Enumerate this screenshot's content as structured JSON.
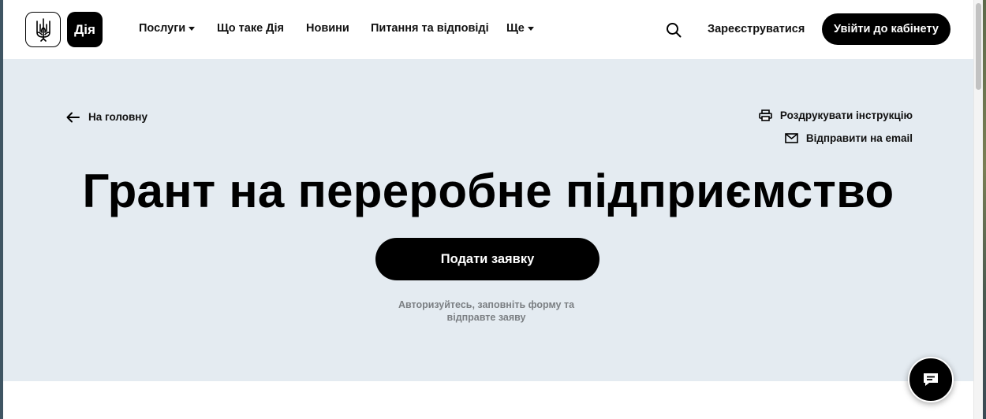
{
  "header": {
    "logo_text": "Дія",
    "nav": [
      {
        "label": "Послуги",
        "dropdown": true
      },
      {
        "label": "Що таке Дія",
        "dropdown": false
      },
      {
        "label": "Новини",
        "dropdown": false
      },
      {
        "label": "Питання та відповіді",
        "dropdown": false
      },
      {
        "label": "Ще",
        "dropdown": true
      }
    ],
    "register_label": "Зареєструватися",
    "login_label": "Увійти до кабінету",
    "icons": {
      "search": "search-icon",
      "coat_of_arms": "tryzub-icon"
    }
  },
  "hero": {
    "back_label": "На головну",
    "print_label": "Роздрукувати інструкцію",
    "email_label": "Відправити на email",
    "title": "Грант на переробне підприємство",
    "apply_label": "Подати заявку",
    "hint": "Авторизуйтесь, заповніть форму та відправте заяву",
    "background_color": "#e4ebf1"
  },
  "chat": {
    "icon": "chat-icon"
  }
}
